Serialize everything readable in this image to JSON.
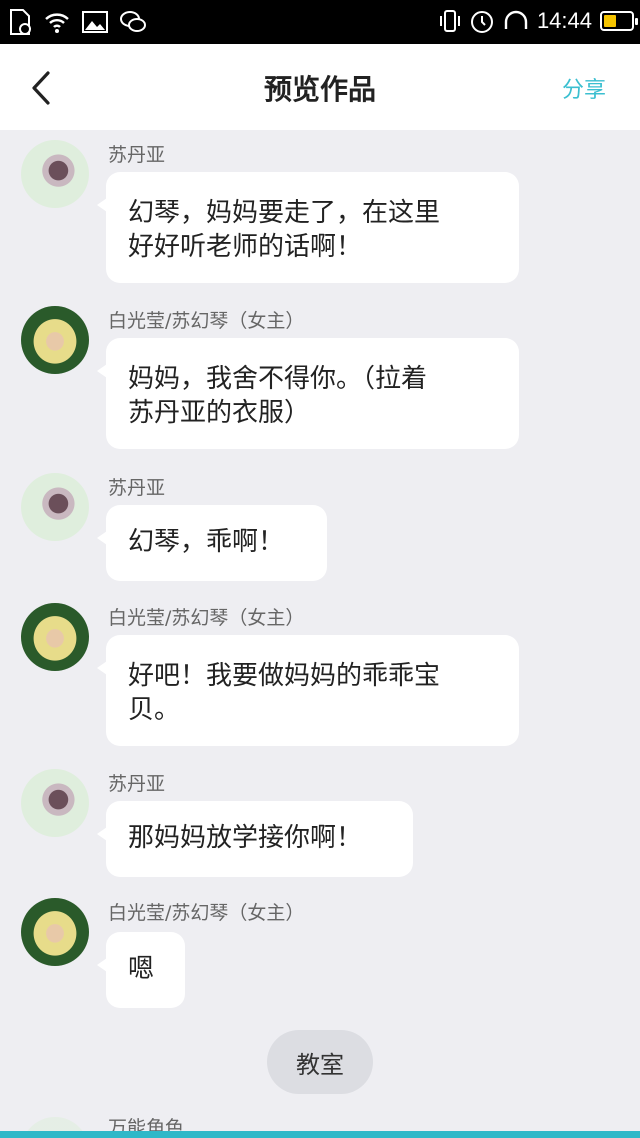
{
  "status_bar": {
    "time": "14:44"
  },
  "nav": {
    "title": "预览作品",
    "share_label": "分享"
  },
  "messages": [
    {
      "sender": "苏丹亚",
      "text_line1": "幻琴，妈妈要走了，在这里",
      "text_line2": "好好听老师的话啊！"
    },
    {
      "sender": "白光莹/苏幻琴（女主）",
      "text_line1": "妈妈，我舍不得你。（拉着",
      "text_line2": "苏丹亚的衣服）"
    },
    {
      "sender": "苏丹亚",
      "text_line1": "幻琴，乖啊！"
    },
    {
      "sender": "白光莹/苏幻琴（女主）",
      "text_line1": "好吧！我要做妈妈的乖乖宝",
      "text_line2": "贝。"
    },
    {
      "sender": "苏丹亚",
      "text_line1": "那妈妈放学接你啊！"
    },
    {
      "sender": "白光莹/苏幻琴（女主）",
      "text_line1": "嗯"
    },
    {
      "sender": "万能角色"
    }
  ],
  "scene_tag": "教室",
  "colors": {
    "accent": "#3bbfd0",
    "background": "#eeeef2",
    "bubble": "#ffffff"
  }
}
